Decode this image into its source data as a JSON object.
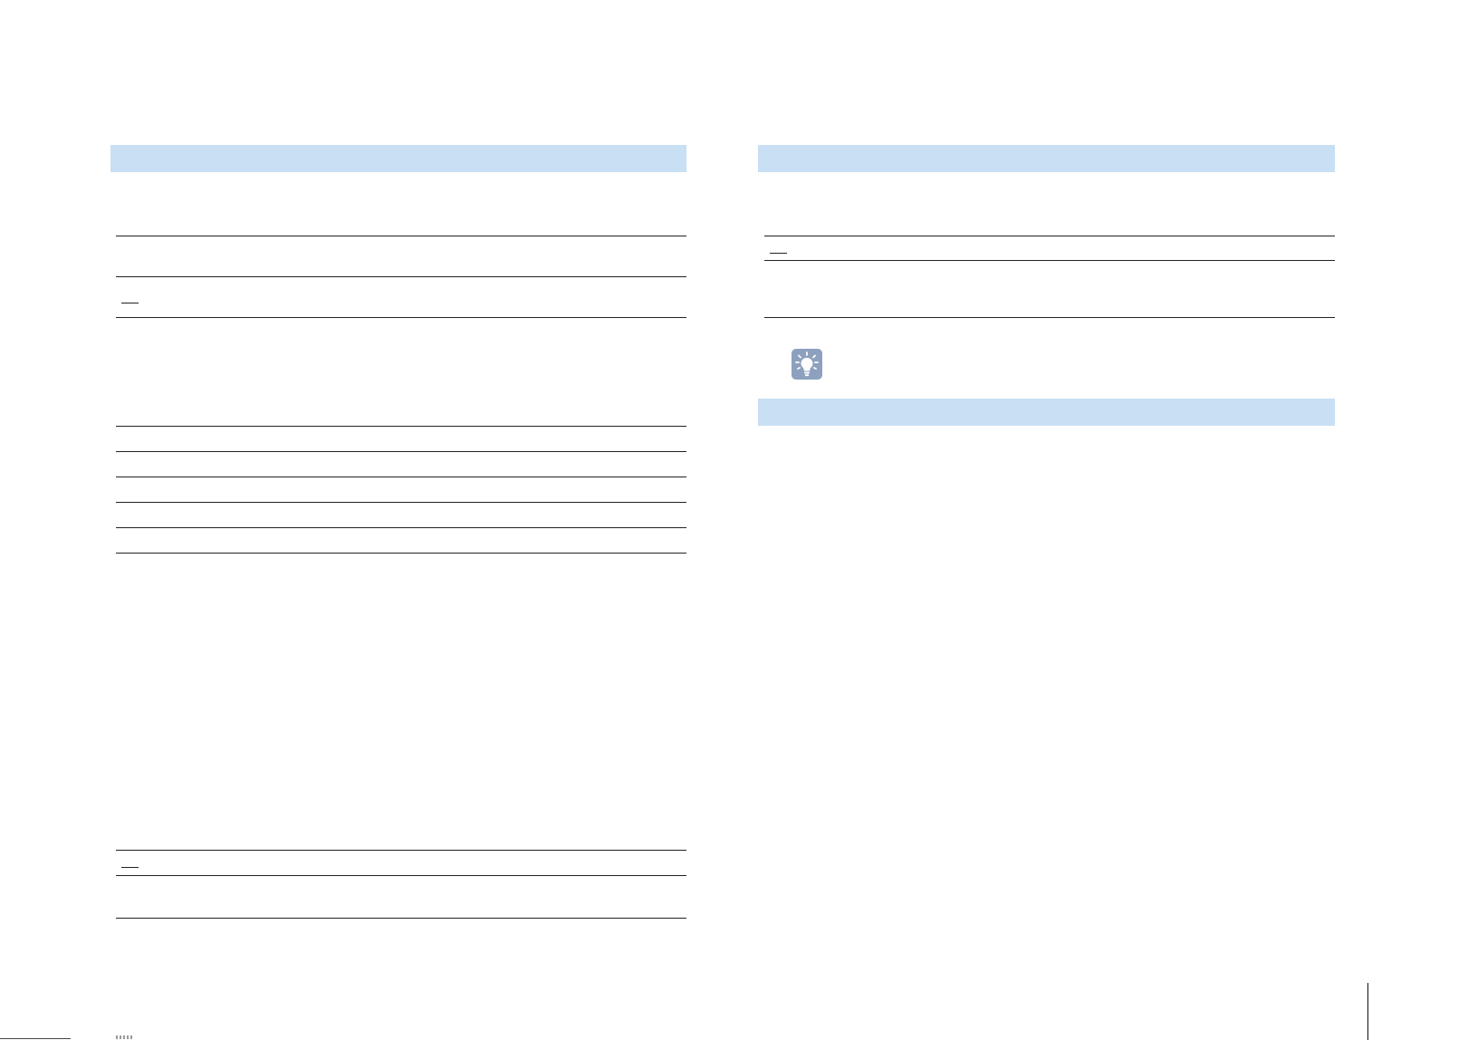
{
  "page": {
    "left_column": {
      "section_bands": 1,
      "rules": 11,
      "marks": 3
    },
    "right_column": {
      "section_bands": 2,
      "rules": 3,
      "marks": 1,
      "tip_icon": "lightbulb-icon"
    },
    "colors": {
      "section_band": "#c8dff4",
      "rule": "#222222",
      "tip_icon_bg": "#8da0be"
    }
  }
}
